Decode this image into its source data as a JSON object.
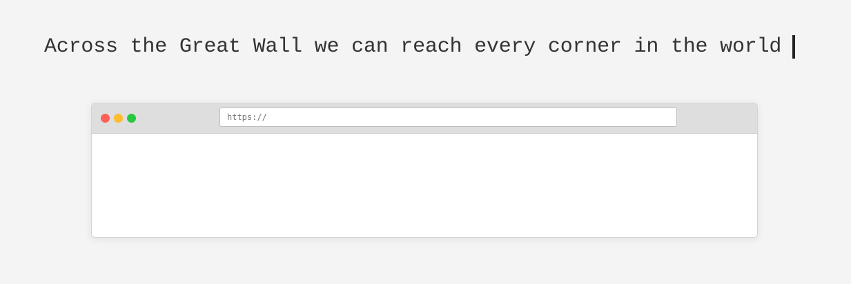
{
  "headline": {
    "text": "Across the Great Wall we can reach every corner in the world"
  },
  "browser": {
    "address_placeholder": "https://",
    "address_value": "",
    "traffic_lights": {
      "close_color": "#ff5f57",
      "minimize_color": "#febc2e",
      "maximize_color": "#28c840"
    }
  },
  "colors": {
    "background": "#f4f4f4",
    "titlebar": "#dedede",
    "text": "#333333"
  },
  "icons": {
    "close": "close-icon",
    "minimize": "minimize-icon",
    "maximize": "maximize-icon"
  }
}
